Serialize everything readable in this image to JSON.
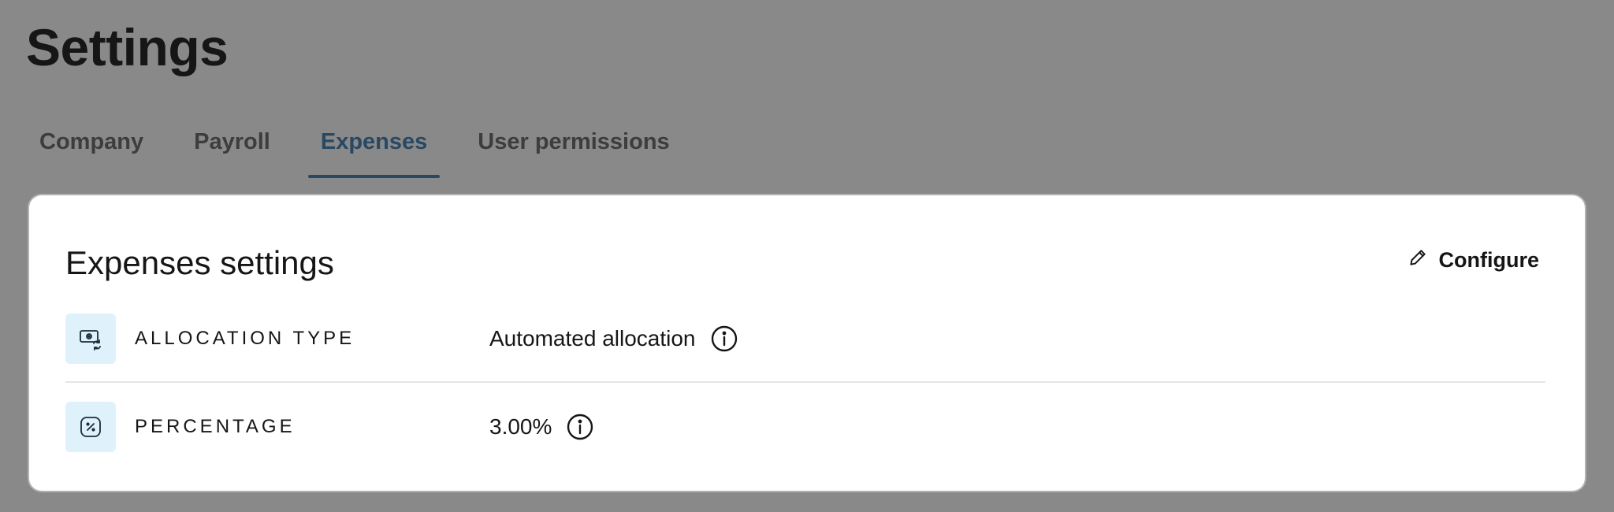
{
  "page": {
    "title": "Settings"
  },
  "tabs": [
    {
      "label": "Company",
      "active": false
    },
    {
      "label": "Payroll",
      "active": false
    },
    {
      "label": "Expenses",
      "active": true
    },
    {
      "label": "User permissions",
      "active": false
    }
  ],
  "card": {
    "title": "Expenses settings",
    "configure_label": "Configure",
    "configure_icon": "pencil-icon",
    "rows": [
      {
        "icon": "money-swap-icon",
        "label": "ALLOCATION TYPE",
        "value": "Automated allocation",
        "info_icon": "info-icon"
      },
      {
        "icon": "percent-icon",
        "label": "PERCENTAGE",
        "value": "3.00%",
        "info_icon": "info-icon"
      }
    ]
  },
  "colors": {
    "overlay_background": "#898989",
    "active_tab": "#284863",
    "icon_tile": "#dff1fb",
    "card_background": "#ffffff"
  }
}
